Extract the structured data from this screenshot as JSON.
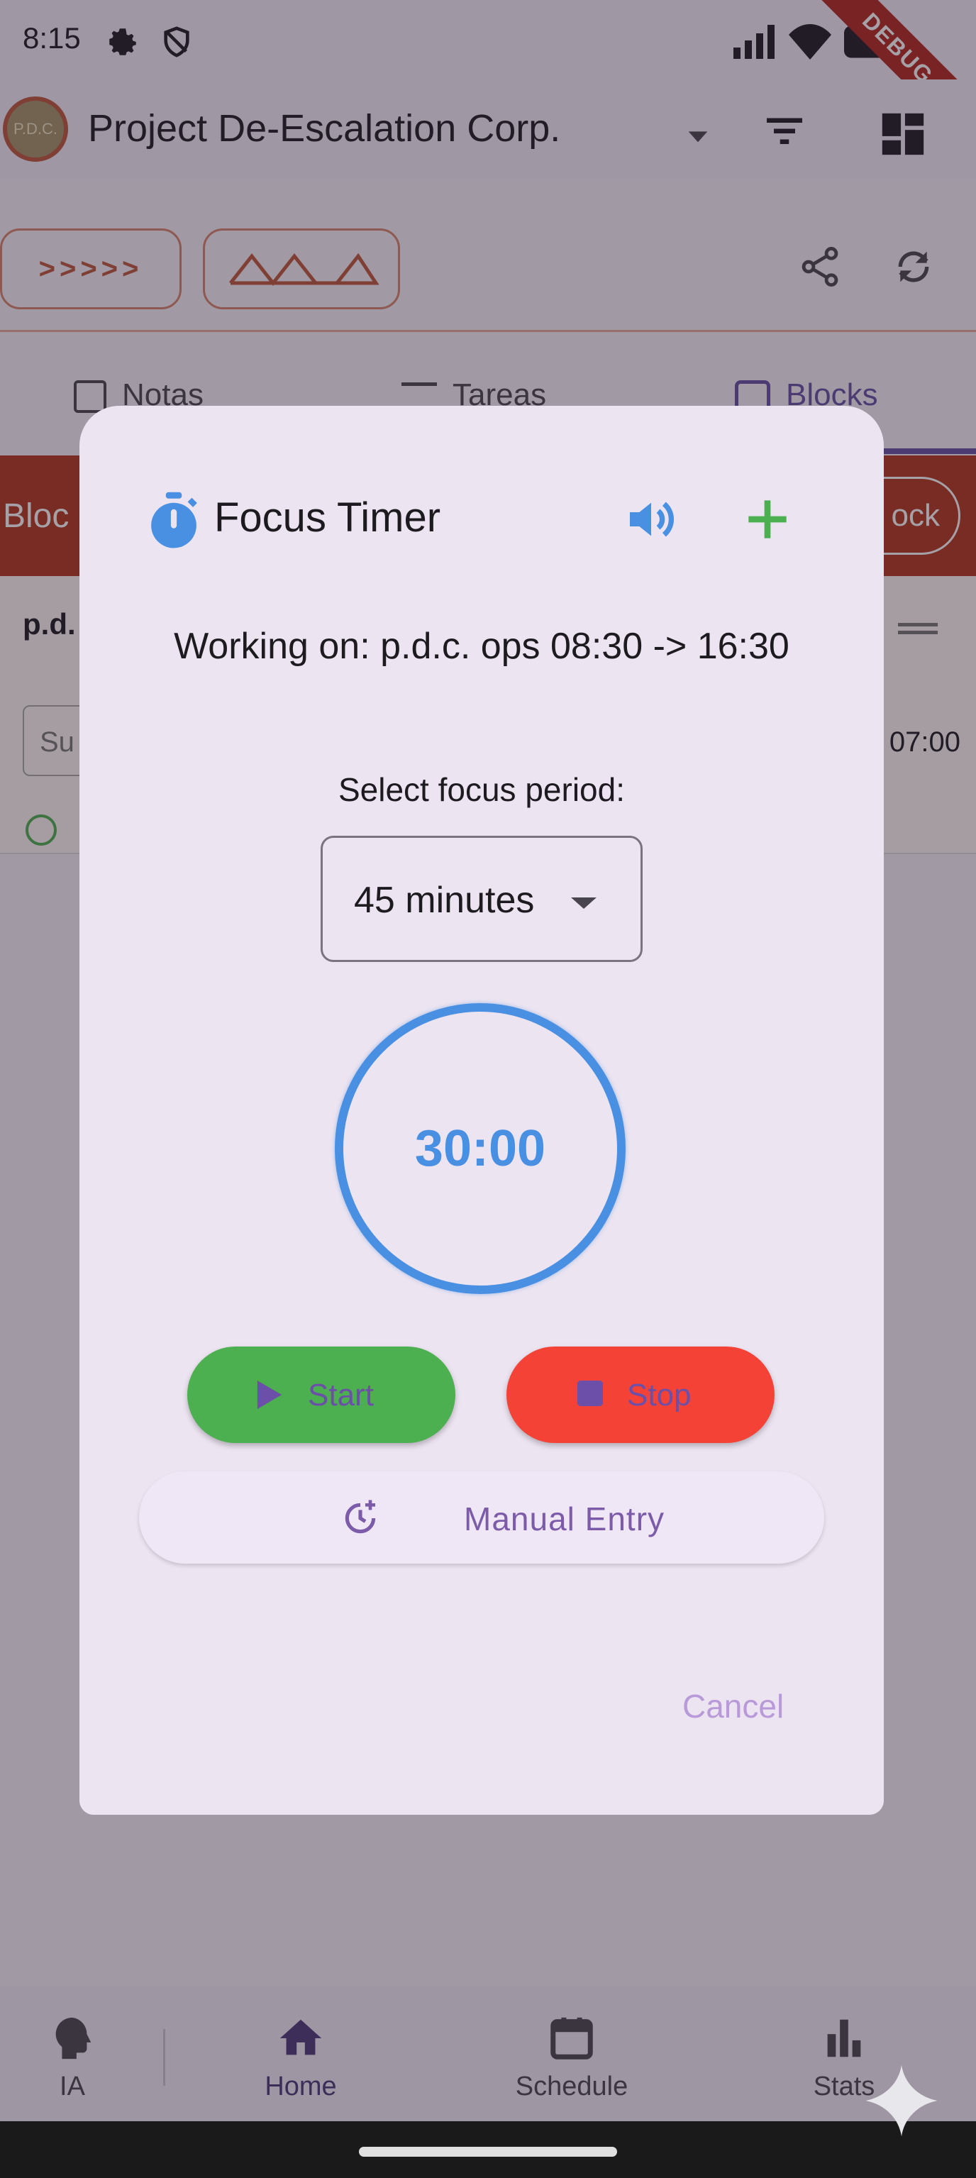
{
  "status_bar": {
    "time": "8:15",
    "debug_banner": "DEBUG"
  },
  "app_bar": {
    "logo_text": "P.D.C.",
    "title": "Project De-Escalation Corp."
  },
  "toolbar": {
    "chip_1": ">>>>>"
  },
  "tabs": [
    {
      "label": "Notas"
    },
    {
      "label": "Tareas"
    },
    {
      "label": "Blocks"
    }
  ],
  "background": {
    "block_bar_label": "Bloc",
    "block_button_label": "ock",
    "card_title": "p.d.",
    "card_input": "Su",
    "card_time": "07:00"
  },
  "dialog": {
    "title": "Focus Timer",
    "working_on": "Working on: p.d.c. ops 08:30 -> 16:30",
    "select_label": "Select focus period:",
    "selected_period": "45 minutes",
    "timer_display": "30:00",
    "start_label": "Start",
    "stop_label": "Stop",
    "manual_entry_label": "Manual Entry",
    "cancel_label": "Cancel"
  },
  "bottom_nav": [
    {
      "label": "IA"
    },
    {
      "label": "Home"
    },
    {
      "label": "Schedule"
    },
    {
      "label": "Stats"
    }
  ],
  "colors": {
    "accent": "#6750a4",
    "timer_blue": "#4a90e2",
    "start_green": "#4caf50",
    "stop_red": "#f44336",
    "block_red": "#b4361e"
  }
}
